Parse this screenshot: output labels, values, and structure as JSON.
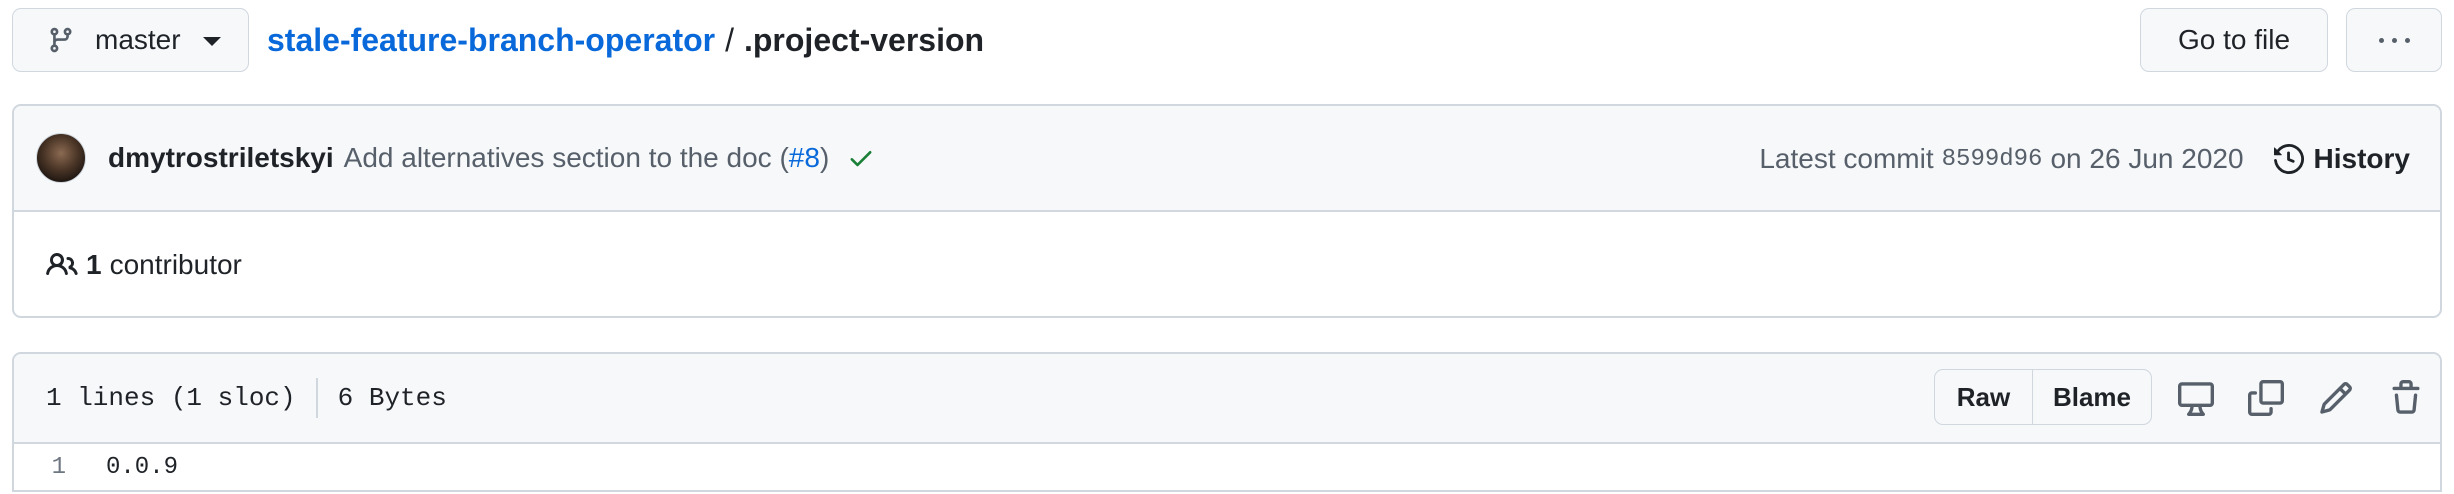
{
  "header": {
    "branch": "master",
    "repo": "stale-feature-branch-operator",
    "separator": "/",
    "file": ".project-version",
    "goto_label": "Go to file"
  },
  "commit": {
    "author": "dmytrostriletskyi",
    "message_prefix": "Add alternatives section to the doc (",
    "pr_link": "#8",
    "message_suffix": ")",
    "latest_label": "Latest commit",
    "sha": "8599d96",
    "date_text": "on 26 Jun 2020",
    "history_label": "History",
    "status": "success",
    "status_color": "#1a7f37"
  },
  "contributors": {
    "count": "1",
    "label": "contributor"
  },
  "file_info": {
    "lines": "1 lines (1 sloc)",
    "size": "6 Bytes",
    "raw_label": "Raw",
    "blame_label": "Blame",
    "icons": [
      "desktop-icon",
      "copy-icon",
      "pencil-icon",
      "trash-icon"
    ]
  },
  "code": [
    {
      "line": "1",
      "text": "0.0.9"
    }
  ]
}
